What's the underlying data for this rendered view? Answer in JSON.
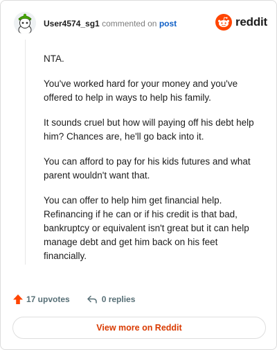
{
  "header": {
    "username": "User4574_sg1",
    "action_text": "commented on",
    "post_link": "post"
  },
  "logo": {
    "wordmark": "reddit",
    "brand_color": "#ff4500"
  },
  "comment": {
    "paragraphs": [
      "NTA.",
      "You've worked hard for your money and you've offered to help in ways to help his family.",
      "It sounds cruel but how will paying off his debt help him? Chances are, he'll go back into it.",
      "You can afford to pay for his kids futures and what parent wouldn't want that.",
      "You can offer to help him get financial help. Refinancing if he can or if his credit is that bad, bankruptcy or equivalent isn't great but it can help manage debt and get him back on his feet financially."
    ]
  },
  "stats": {
    "upvotes": "17 upvotes",
    "replies": "0 replies",
    "upvote_color": "#ff4500"
  },
  "footer": {
    "view_more_label": "View more on Reddit"
  }
}
